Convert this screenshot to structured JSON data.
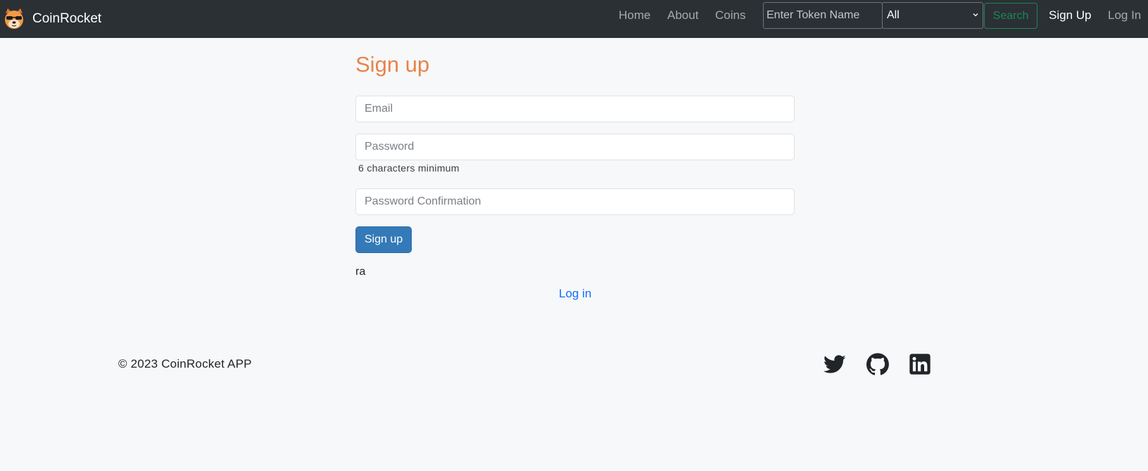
{
  "nav": {
    "brand": "CoinRocket",
    "links": {
      "home": "Home",
      "about": "About",
      "coins": "Coins"
    },
    "search": {
      "placeholder": "Enter Token Name",
      "select_value": "All",
      "button": "Search"
    },
    "signup": "Sign Up",
    "login": "Log In"
  },
  "form": {
    "title": "Sign up",
    "email_placeholder": "Email",
    "password_placeholder": "Password",
    "password_hint": "6 characters minimum",
    "confirm_placeholder": "Password Confirmation",
    "submit_label": "Sign up",
    "extra_text": "ra",
    "login_link": "Log in"
  },
  "footer": {
    "copyright": "© 2023 CoinRocket APP",
    "social_icons": [
      "twitter-icon",
      "github-icon",
      "linkedin-icon"
    ]
  },
  "colors": {
    "navbar": "#2b3035",
    "title_accent": "#e8834a",
    "primary_button": "#3479b8",
    "search_green": "#198754",
    "link_blue": "#0d6efd"
  }
}
